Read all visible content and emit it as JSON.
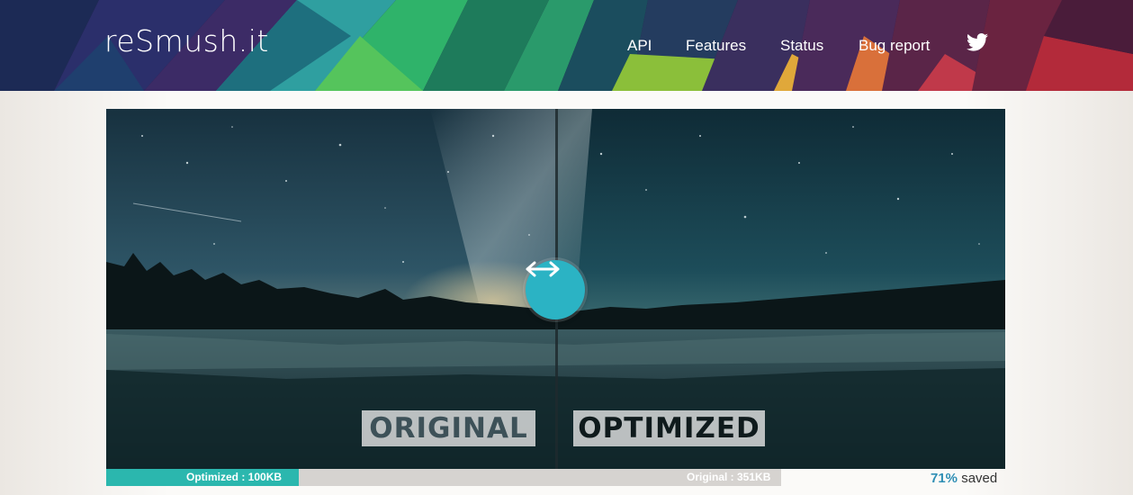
{
  "header": {
    "brand": "reSmush.it",
    "nav": [
      {
        "label": "API"
      },
      {
        "label": "Features"
      },
      {
        "label": "Status"
      },
      {
        "label": "Bug report"
      }
    ],
    "social_icon": "twitter-icon"
  },
  "comparison": {
    "left_label": "ORIGINAL",
    "right_label": "OPTIMIZED",
    "handle_icon": "left-right-arrow-icon"
  },
  "stats": {
    "optimized_text": "Optimized : 100KB",
    "original_text": "Original : 351KB",
    "fill_fraction": 0.285,
    "saved_percent": "71%",
    "saved_word": "saved"
  },
  "colors": {
    "accent": "#2bb3c4",
    "bar_fill": "#2bb7ae",
    "bar_track": "#d6d3d0",
    "percent": "#2f8fb5"
  }
}
